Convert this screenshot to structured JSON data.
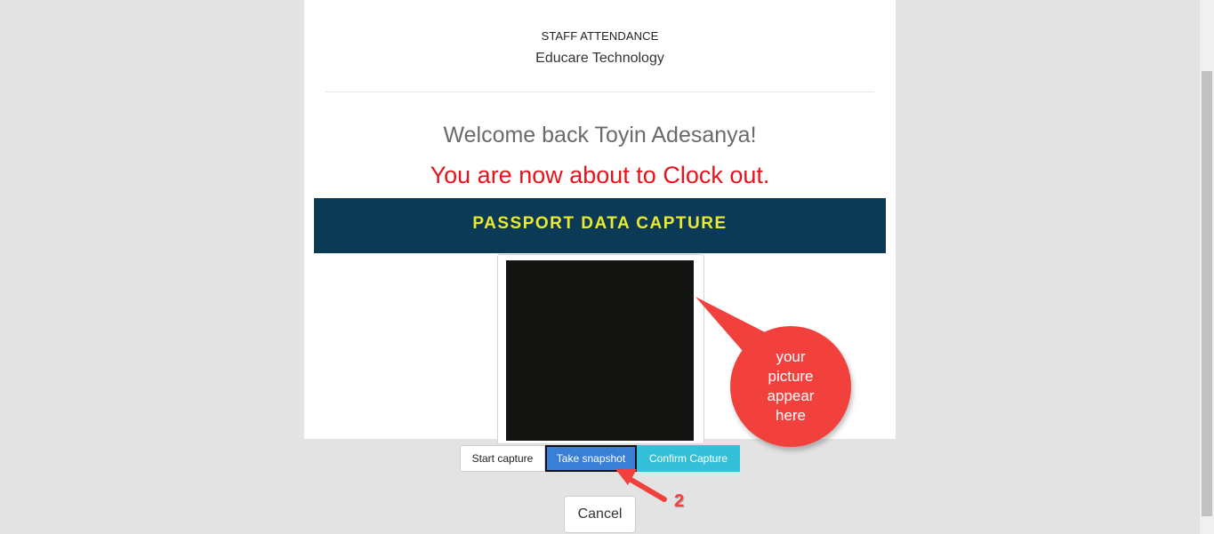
{
  "header": {
    "small_title": "STAFF ATTENDANCE",
    "company": "Educare Technology"
  },
  "main": {
    "welcome": "Welcome back Toyin Adesanya!",
    "action_message": "You are now about to Clock out.",
    "banner_title": "PASSPORT DATA CAPTURE"
  },
  "annotation": {
    "callout_text": "your picture appear here",
    "step_number": "2"
  },
  "buttons": {
    "start_capture": "Start capture",
    "take_snapshot": "Take snapshot",
    "confirm_capture": "Confirm Capture",
    "cancel": "Cancel"
  },
  "colors": {
    "banner_bg": "#0b3a57",
    "banner_text": "#ecea2e",
    "clockout_text": "#e8131b",
    "snapshot_btn": "#3a7fd6",
    "confirm_btn": "#35c0d9",
    "annotation": "#f2413d"
  },
  "icons": {
    "callout": "speech-bubble-callout",
    "pointer": "red-arrow-pointer"
  }
}
